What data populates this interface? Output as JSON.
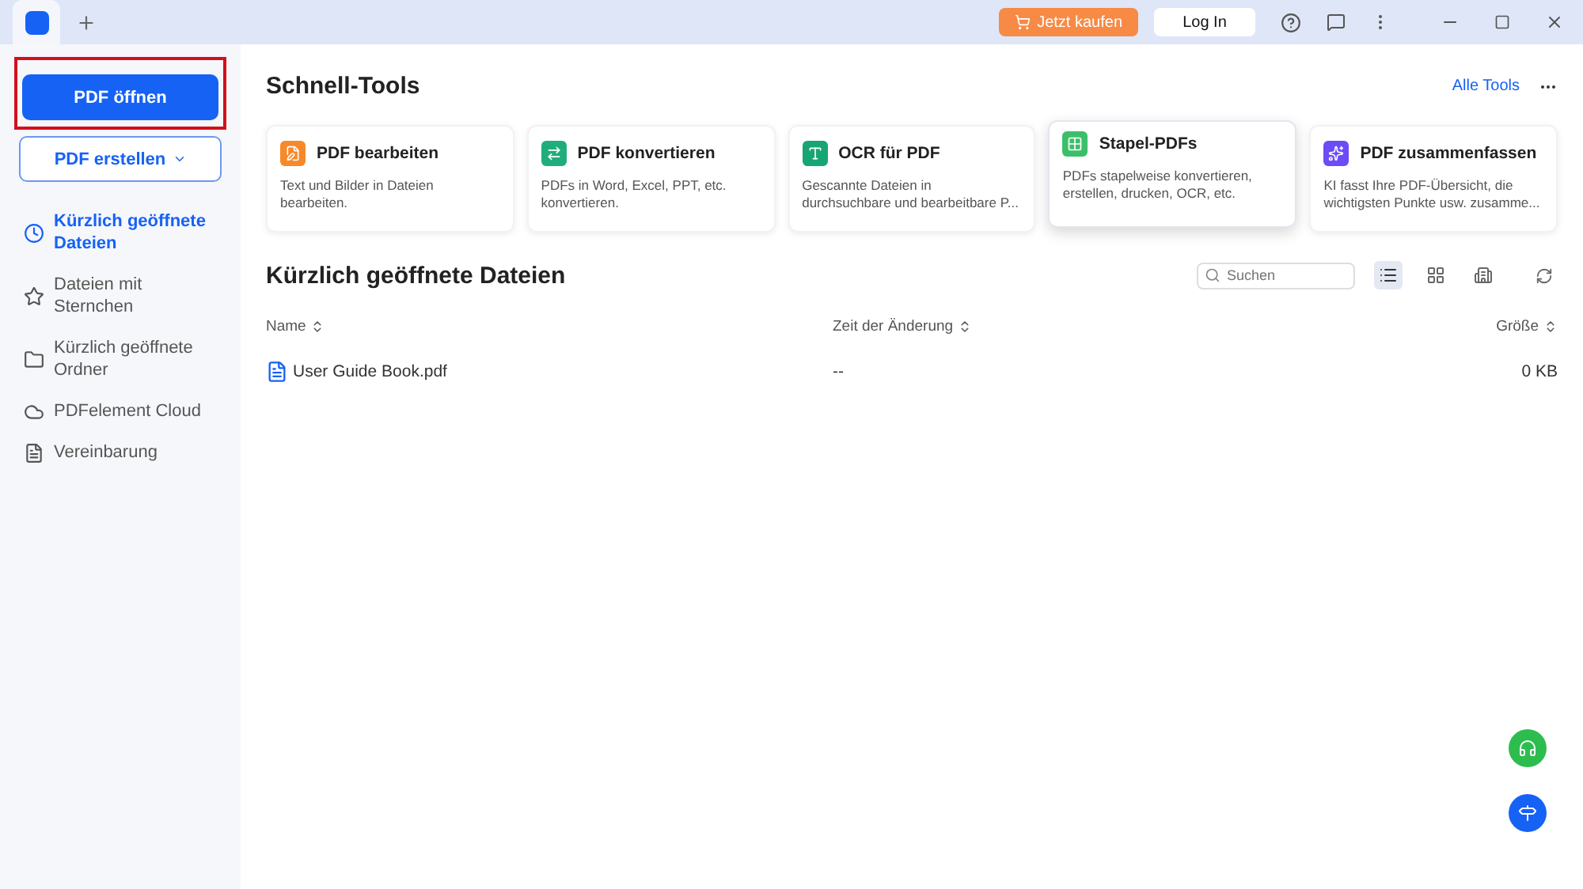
{
  "titlebar": {
    "buy_button": "Jetzt kaufen",
    "login_button": "Log In"
  },
  "sidebar": {
    "open_button": {
      "label": "PDF öffnen",
      "highlighted": true
    },
    "create_button": "PDF erstellen",
    "items": [
      {
        "label": "Kürzlich geöffnete Dateien",
        "kind": "recent",
        "selected": true
      },
      {
        "label": "Dateien mit Sternchen",
        "kind": "starred",
        "selected": false
      },
      {
        "label": "Kürzlich geöffnete Ordner",
        "kind": "folder",
        "selected": false
      },
      {
        "label": "PDFelement Cloud",
        "kind": "cloud",
        "selected": false
      },
      {
        "label": "Vereinbarung",
        "kind": "agreement",
        "selected": false
      }
    ]
  },
  "quick_tools": {
    "title": "Schnell-Tools",
    "all_tools_link": "Alle Tools",
    "cards": [
      {
        "title": "PDF bearbeiten",
        "description": "Text und Bilder in Dateien bearbeiten.",
        "kind": "edit",
        "color": "#f7892b",
        "hovered": false
      },
      {
        "title": "PDF konvertieren",
        "description": "PDFs in Word, Excel, PPT, etc. konvertieren.",
        "kind": "convert",
        "color": "#1fae7b",
        "hovered": false
      },
      {
        "title": "OCR für PDF",
        "description": "Gescannte Dateien in durchsuchbare und bearbeitbare P...",
        "kind": "ocr",
        "color": "#17a673",
        "hovered": false
      },
      {
        "title": "Stapel-PDFs",
        "description": "PDFs stapelweise konvertieren, erstellen, drucken, OCR, etc.",
        "kind": "batch",
        "color": "#3cbf6a",
        "hovered": true
      },
      {
        "title": "PDF zusammenfassen",
        "description": "KI fasst Ihre PDF-Übersicht, die wichtigsten Punkte usw. zusamme...",
        "kind": "summarize",
        "color": "#6b4cf6",
        "hovered": false
      }
    ]
  },
  "recent_files": {
    "title": "Kürzlich geöffnete Dateien",
    "search": {
      "placeholder": "Suchen"
    },
    "views": [
      {
        "kind": "list",
        "selected": true
      },
      {
        "kind": "grid",
        "selected": false
      }
    ],
    "columns": [
      "Name",
      "Zeit der Änderung",
      "Größe"
    ],
    "rows": [
      {
        "name": "User Guide Book.pdf",
        "modified": "--",
        "size": "0 KB"
      }
    ]
  }
}
